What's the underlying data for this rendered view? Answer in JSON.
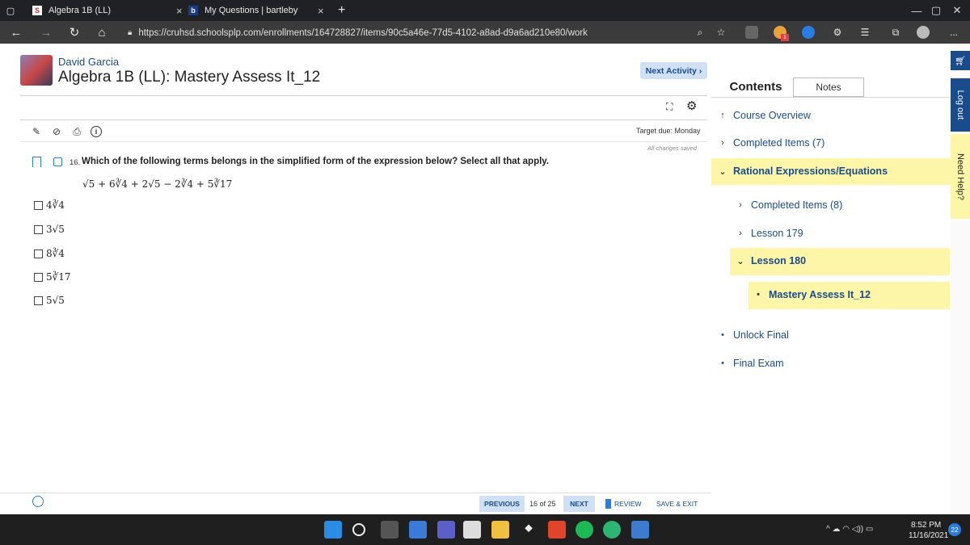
{
  "browser": {
    "tabs": [
      {
        "label": "Algebra 1B (LL)",
        "favicon": "S"
      },
      {
        "label": "My Questions | bartleby",
        "favicon": "b"
      }
    ],
    "new_tab": "+",
    "url": "https://cruhsd.schoolsplp.com/enrollments/164728827/items/90c5a46e-77d5-4102-a8ad-d9a6ad210e80/work",
    "ext_badge": "1",
    "more": "...",
    "window_controls": [
      "—",
      "▢",
      "✕"
    ]
  },
  "header": {
    "student_name": "David Garcia",
    "course_title": "Algebra 1B (LL): Mastery Assess It_12",
    "next_activity": "Next Activity ›"
  },
  "tools": {
    "target_due": "Target due: Monday",
    "saved_status": "All changes saved"
  },
  "question": {
    "number": "16.",
    "text": "Which of the following terms belongs in the simplified form of the expression below? Select all that apply.",
    "expression": "√5 + 6∛4 + 2√5 − 2∛4 + 5∛17",
    "choices": [
      "4∛4",
      "3√5",
      "8∛4",
      "5∛17",
      "5√5"
    ]
  },
  "sidebar": {
    "tab_contents": "Contents",
    "tab_notes": "Notes",
    "items": [
      {
        "icon": "↑",
        "label": "Course Overview"
      },
      {
        "icon": "›",
        "label": "Completed Items (7)"
      },
      {
        "icon": "⌄",
        "label": "Rational Expressions/Equations"
      },
      {
        "icon": "›",
        "label": "Completed Items (8)"
      },
      {
        "icon": "›",
        "label": "Lesson 179"
      },
      {
        "icon": "⌄",
        "label": "Lesson 180"
      },
      {
        "icon": "•",
        "label": "Mastery Assess It_12"
      },
      {
        "icon": "•",
        "label": "Unlock Final"
      },
      {
        "icon": "•",
        "label": "Final Exam"
      }
    ]
  },
  "right_strip": {
    "logout": "Log out",
    "help": "Need Help?"
  },
  "footer": {
    "previous": "PREVIOUS",
    "pager": "16 of 25",
    "next": "NEXT",
    "review": "REVIEW",
    "save_exit": "SAVE & EXIT"
  },
  "taskbar": {
    "time": "8:52 PM",
    "date": "11/16/2021",
    "notifications": "22",
    "tray_symbols": "^ ☁ ◠ ◁)) ▭"
  },
  "colors": {
    "accent": "#1a4b8c",
    "highlight": "#fdf6a8",
    "button_bg": "#cfe0f7"
  }
}
